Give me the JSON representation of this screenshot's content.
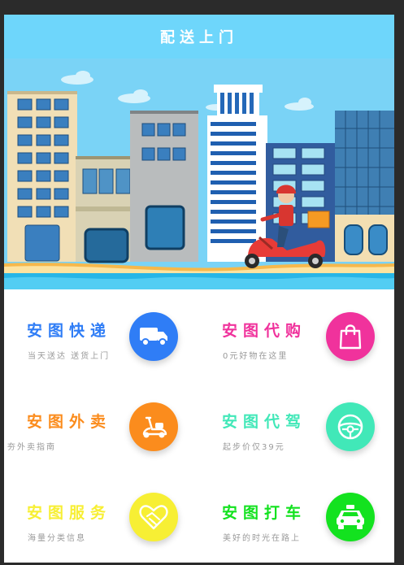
{
  "header": {
    "title": "配送上门"
  },
  "services": [
    {
      "name": "安图快递",
      "sub": "当天送达 送货上门",
      "icon": "truck-icon",
      "color": "#2f7df6"
    },
    {
      "name": "安图代购",
      "sub": "0元好物在这里",
      "icon": "shopping-bag-icon",
      "color": "#f0329c"
    },
    {
      "name": "安图外卖",
      "sub": "夯外卖指南",
      "icon": "scooter-icon",
      "color": "#fb8c1d"
    },
    {
      "name": "安图代驾",
      "sub": "起步价仅39元",
      "icon": "steering-wheel-icon",
      "color": "#41e8b8"
    },
    {
      "name": "安图服务",
      "sub": "海量分类信息",
      "icon": "handshake-heart-icon",
      "color": "#f7ef34"
    },
    {
      "name": "安图打车",
      "sub": "美好的时光在路上",
      "icon": "taxi-icon",
      "color": "#13e21f"
    }
  ]
}
